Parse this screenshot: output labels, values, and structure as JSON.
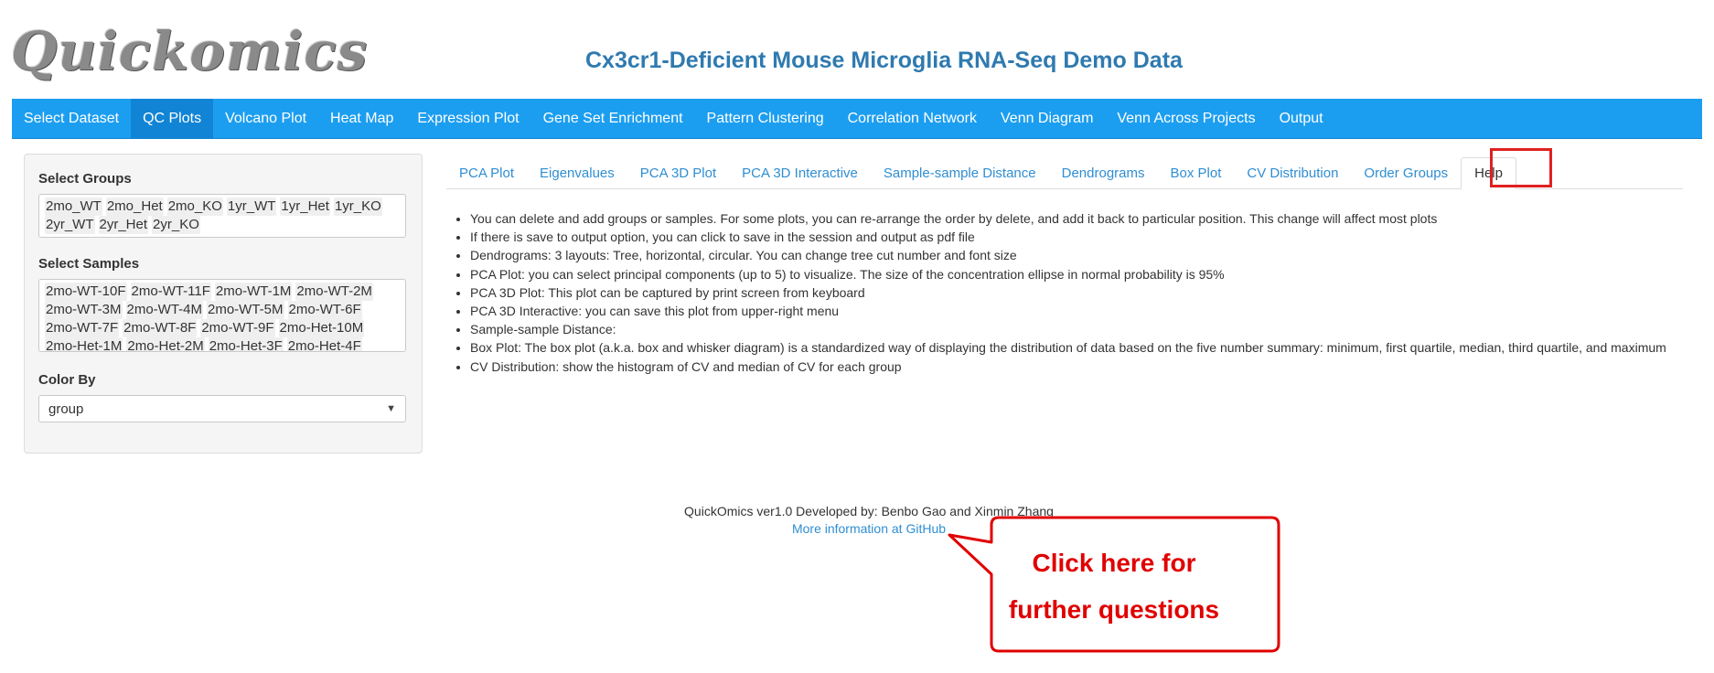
{
  "header": {
    "logo": "Quickomics",
    "title": "Cx3cr1-Deficient Mouse Microglia RNA-Seq Demo Data"
  },
  "navbar": {
    "active_index": 1,
    "items": [
      "Select Dataset",
      "QC Plots",
      "Volcano Plot",
      "Heat Map",
      "Expression Plot",
      "Gene Set Enrichment",
      "Pattern Clustering",
      "Correlation Network",
      "Venn Diagram",
      "Venn Across Projects",
      "Output"
    ]
  },
  "sidebar": {
    "groups_label": "Select Groups",
    "groups": [
      "2mo_WT",
      "2mo_Het",
      "2mo_KO",
      "1yr_WT",
      "1yr_Het",
      "1yr_KO",
      "2yr_WT",
      "2yr_Het",
      "2yr_KO"
    ],
    "samples_label": "Select Samples",
    "samples": [
      "2mo-WT-10F",
      "2mo-WT-11F",
      "2mo-WT-1M",
      "2mo-WT-2M",
      "2mo-WT-3M",
      "2mo-WT-4M",
      "2mo-WT-5M",
      "2mo-WT-6F",
      "2mo-WT-7F",
      "2mo-WT-8F",
      "2mo-WT-9F",
      "2mo-Het-10M",
      "2mo-Het-1M",
      "2mo-Het-2M",
      "2mo-Het-3F",
      "2mo-Het-4F"
    ],
    "color_by_label": "Color By",
    "color_by_value": "group"
  },
  "tabs": {
    "active_index": 10,
    "items": [
      "PCA Plot",
      "Eigenvalues",
      "PCA 3D Plot",
      "PCA 3D Interactive",
      "Sample-sample Distance",
      "Dendrograms",
      "Box Plot",
      "CV Distribution",
      "Order Groups",
      "Help"
    ]
  },
  "help_items": [
    "You can delete and add groups or samples. For some plots, you can re-arrange the order by delete, and add it back to particular position. This change will affect most plots",
    "If there is save to output option, you can click to save in the session and output as pdf file",
    "Dendrograms: 3 layouts: Tree, horizontal, circular. You can change tree cut number and font size",
    "PCA Plot: you can select principal components (up to 5) to visualize. The size of the concentration ellipse in normal probability is 95%",
    "PCA 3D Plot: This plot can be captured by print screen from keyboard",
    "PCA 3D Interactive: you can save this plot from upper-right menu",
    "Sample-sample Distance:",
    "Box Plot: The box plot (a.k.a. box and whisker diagram) is a standardized way of displaying the distribution of data based on the five number summary: minimum, first quartile, median, third quartile, and maximum",
    "CV Distribution: show the histogram of CV and median of CV for each group"
  ],
  "footer": {
    "credit": "QuickOmics ver1.0 Developed by: Benbo Gao and Xinmin Zhang",
    "link": "More information at GitHub"
  },
  "callout": {
    "line1": "Click here for",
    "line2": "further questions",
    "color": "#e00000"
  }
}
